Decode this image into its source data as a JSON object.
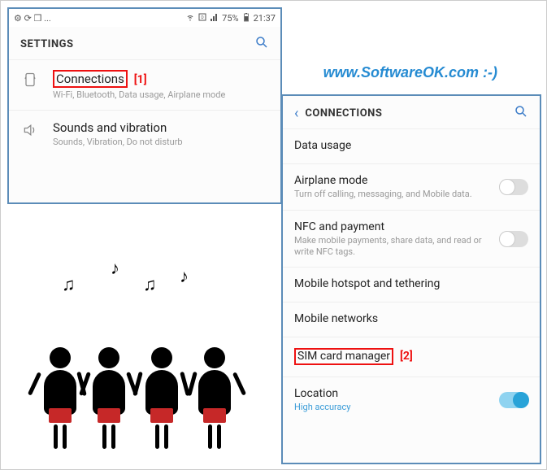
{
  "watermark": "www.SoftwareOK.com :-)",
  "status_bar": {
    "left_icons": "⚙ ⟳ ❒ ...",
    "battery_text": "75%",
    "time": "21:37"
  },
  "settings": {
    "title": "SETTINGS",
    "items": [
      {
        "title": "Connections",
        "subtitle": "Wi-Fi, Bluetooth, Data usage, Airplane mode",
        "highlighted": true,
        "marker": "[1]"
      },
      {
        "title": "Sounds and vibration",
        "subtitle": "Sounds, Vibration, Do not disturb"
      }
    ]
  },
  "connections": {
    "title": "CONNECTIONS",
    "items": [
      {
        "title": "Data usage",
        "subtitle": ""
      },
      {
        "title": "Airplane mode",
        "subtitle": "Turn off calling, messaging, and Mobile data.",
        "toggle": false
      },
      {
        "title": "NFC and payment",
        "subtitle": "Make mobile payments, share data, and read or write NFC tags.",
        "toggle": false
      },
      {
        "title": "Mobile hotspot and tethering",
        "subtitle": ""
      },
      {
        "title": "Mobile networks",
        "subtitle": ""
      },
      {
        "title": "SIM card manager",
        "subtitle": "",
        "highlighted": true,
        "marker": "[2]"
      },
      {
        "title": "Location",
        "subtitle": "High accuracy",
        "toggle": true,
        "accent": true
      }
    ]
  }
}
